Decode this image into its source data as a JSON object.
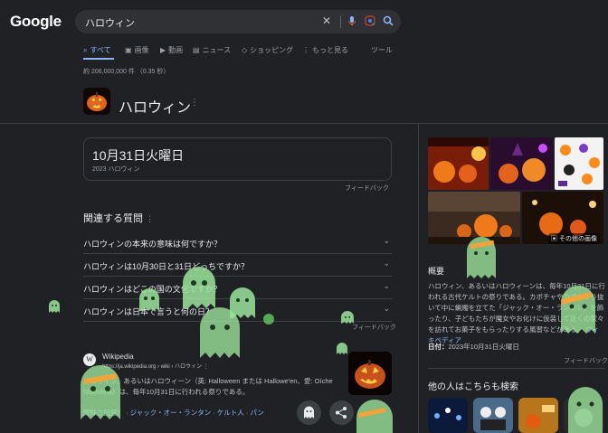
{
  "header": {
    "logo": "Google",
    "search_value": "ハロウィン"
  },
  "tabs": [
    {
      "label": "すべて",
      "icon": "search-icon",
      "active": true
    },
    {
      "label": "画像",
      "icon": "image-icon"
    },
    {
      "label": "動画",
      "icon": "video-icon"
    },
    {
      "label": "ニュース",
      "icon": "news-icon"
    },
    {
      "label": "ショッピング",
      "icon": "tag-icon"
    },
    {
      "label": "もっと見る",
      "icon": "more-icon"
    }
  ],
  "tools_label": "ツール",
  "result_stats": "約 206,000,000 件 （0.35 秒）",
  "entity": {
    "title": "ハロウィン",
    "date_main": "10月31日火曜日",
    "date_sub": "2023 ハロウィン",
    "feedback": "フィードバック"
  },
  "related_questions": {
    "title": "関連する質問",
    "items": [
      "ハロウィンの本来の意味は何ですか？",
      "ハロウィンは10月30日と31日どっちですか？",
      "ハロウィンはどこの国の文化ですか？",
      "ハロウィンは日本で言うと何の日？"
    ],
    "feedback": "フィードバック"
  },
  "wiki_result": {
    "source": "Wikipedia",
    "url": "https://ja.wikipedia.org › wiki › ハロウィン",
    "snippet_1": "ハロウィン、あるいはハロウィーン（英: Halloween または Hallowe'en、愛: Oíche Shamhna）は、毎年10月31日に行われる祭りである。",
    "links": "曖昧さ回避） · ジャック・オー・ランタン · ケルト人 · パン"
  },
  "side_panel": {
    "more_images": "その他の画像",
    "overview_title": "概要",
    "overview_text": "ハロウィン、あるいはハロウィーンは、毎年10月31日に行われる古代ケルトの祭りである。カボチャやカブをくり抜いて中に蝋燭を立てた「ジャック・オー・ランタン」を飾ったり、子どもたちが魔女やお化けに仮装して近くの家々を訪れてお菓子をもらったりする風習などがある。",
    "overview_link": "ウィキペディア",
    "date_label": "日付：",
    "date_value": "2023年10月31日火曜日",
    "feedback": "フィードバック",
    "also_search": "他の人はこちらも検索"
  },
  "colors": {
    "background": "#202124",
    "accent_blue": "#8ab4f8",
    "ghost_green": "#9be39b"
  }
}
